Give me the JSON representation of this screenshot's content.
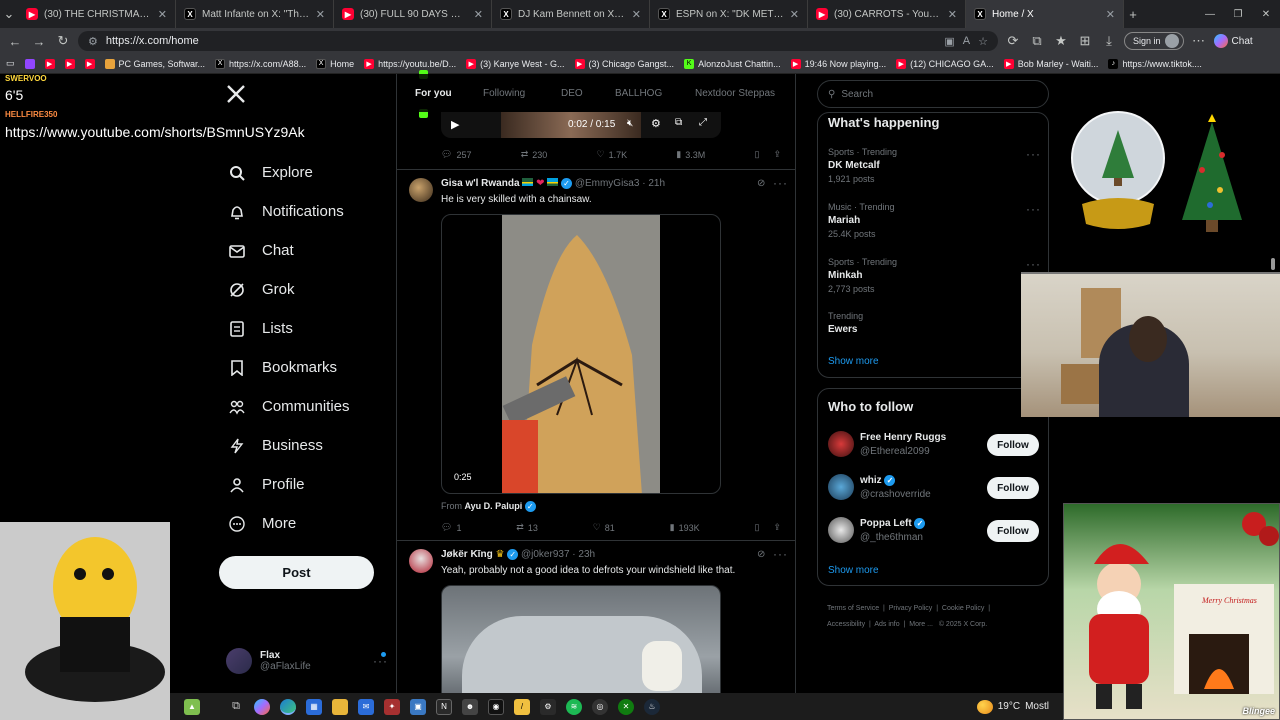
{
  "browser": {
    "tabs": [
      {
        "title": "(30) THE CHRISTMAS DROPOUT",
        "icon": "youtube-icon"
      },
      {
        "title": "Matt Infante on X: \"The Dolphins",
        "icon": "x-icon"
      },
      {
        "title": "(30) FULL 90 DAYS OF DEVELOPM",
        "icon": "youtube-icon"
      },
      {
        "title": "DJ Kam Bennett on X: \"bro thoug",
        "icon": "x-icon"
      },
      {
        "title": "ESPN on X: \"DK METCALF SAID G",
        "icon": "x-icon"
      },
      {
        "title": "(30) CARROTS - YouTube",
        "icon": "youtube-icon"
      },
      {
        "title": "Home / X",
        "icon": "x-icon"
      }
    ],
    "url": "https://x.com/home",
    "sign_in": "Sign in",
    "chat": "Chat",
    "bookmarks": [
      "PC Games, Softwar...",
      "https://x.com/A88...",
      "Home",
      "https://youtu.be/D...",
      "(3) Kanye West - G...",
      "(3) Chicago Gangst...",
      "AlonzoJust Chattin...",
      "19:46 Now playing...",
      "(12) CHICAGO GA...",
      "Bob Marley - Waiti...",
      "https://www.tiktok...."
    ]
  },
  "overlay": {
    "user1": "SWERVOO",
    "msg1": "6'5",
    "user2": "HELLFIRE350",
    "msg2": "https://www.youtube.com/shorts/BSmnUSYz9Ak"
  },
  "nav": {
    "items": [
      "Explore",
      "Notifications",
      "Chat",
      "Grok",
      "Lists",
      "Bookmarks",
      "Communities",
      "Business",
      "Profile",
      "More"
    ],
    "post": "Post",
    "profile_name": "Flax",
    "profile_handle": "@aFlaxLife"
  },
  "feed": {
    "tabs": [
      "For you",
      "Following",
      "DEO",
      "BALLHOG",
      "Nextdoor Steppas"
    ],
    "video_time": "0:02 / 0:15",
    "t0": {
      "replies": "257",
      "reposts": "230",
      "likes": "1.7K",
      "views": "3.3M"
    },
    "t1": {
      "name": "Gisa w'l Rwanda",
      "handle": "@EmmyGisa3",
      "time": "21h",
      "text": "He is very skilled with a chainsaw.",
      "duration": "0:25",
      "from_label": "From",
      "from_name": "Ayu D. Palupi",
      "replies": "1",
      "reposts": "13",
      "likes": "81",
      "views": "193K"
    },
    "t2": {
      "name": "Jøkër Kīng",
      "handle": "@j0ker937",
      "time": "23h",
      "text": "Yeah, probably not a good idea to defrots your windshield like that."
    }
  },
  "right": {
    "search_placeholder": "Search",
    "happening_title": "What's happening",
    "trends": [
      {
        "category": "Sports · Trending",
        "name": "DK Metcalf",
        "count": "1,921 posts"
      },
      {
        "category": "Music · Trending",
        "name": "Mariah",
        "count": "25.4K posts"
      },
      {
        "category": "Sports · Trending",
        "name": "Minkah",
        "count": "2,773 posts"
      },
      {
        "category": "Trending",
        "name": "Ewers",
        "count": ""
      }
    ],
    "show_more": "Show more",
    "follow_title": "Who to follow",
    "follow": [
      {
        "name": "Free Henry Ruggs",
        "handle": "@Ethereal2099",
        "btn": "Follow"
      },
      {
        "name": "whiz",
        "handle": "@crashoverride",
        "btn": "Follow"
      },
      {
        "name": "Poppa Left",
        "handle": "@_the6thman",
        "btn": "Follow"
      }
    ],
    "footer": [
      "Terms of Service",
      "Privacy Policy",
      "Cookie Policy",
      "Accessibility",
      "Ads info",
      "More ...",
      "© 2025 X Corp."
    ]
  },
  "taskbar": {
    "weather": "19°C",
    "weather_text": "Mostl"
  },
  "decor": {
    "merry": "Merry Christmas",
    "blingee": "Blingee"
  }
}
